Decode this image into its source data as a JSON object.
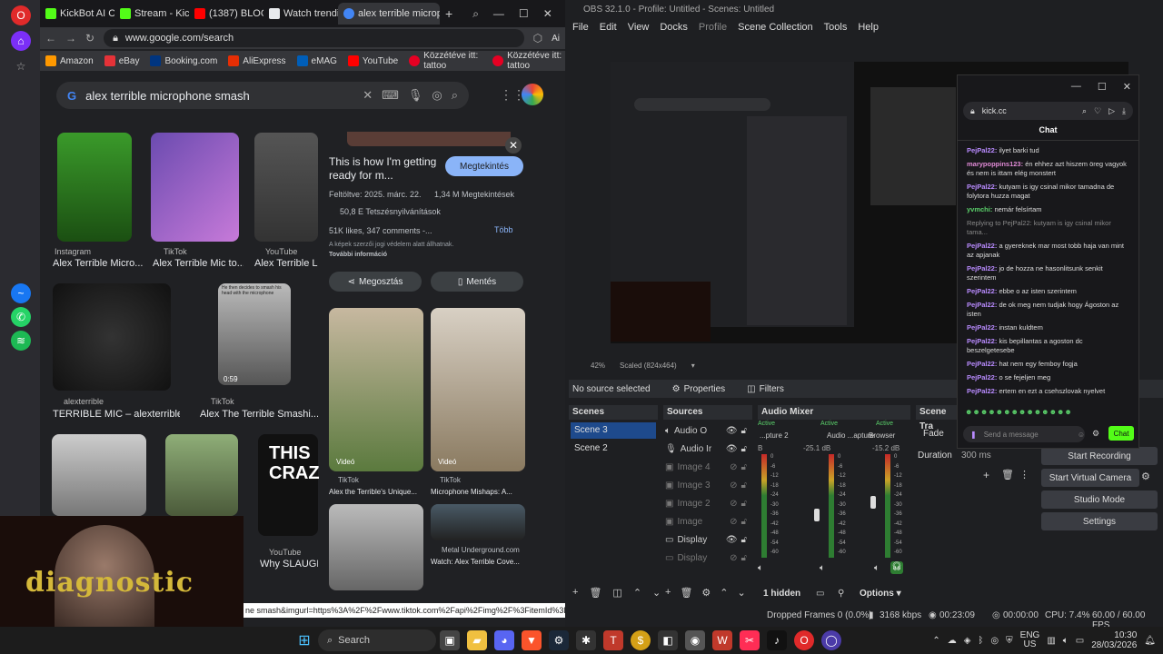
{
  "browser": {
    "tabs": [
      {
        "label": "KickBot AI Chara",
        "color": "#53fc18"
      },
      {
        "label": "Stream - Kick Da",
        "color": "#53fc18"
      },
      {
        "label": "(1387) BLOODY",
        "color": "#ff0000"
      },
      {
        "label": "Watch trending",
        "color": "#e8eaed"
      },
      {
        "label": "alex terrible microphone",
        "color": "#4285f4"
      }
    ],
    "url": "www.google.com/search",
    "bookmarks": [
      "Amazon",
      "eBay",
      "Booking.com",
      "AliExpress",
      "eMAG",
      "YouTube",
      "Közzétéve itt: tattoo",
      "Közzétéve itt: tattoo"
    ],
    "search_query": "alex terrible microphone smash",
    "results": [
      {
        "source": "Instagram",
        "title": "Alex Terrible Micro..."
      },
      {
        "source": "TikTok",
        "title": "Alex Terrible Mic to..."
      },
      {
        "source": "YouTube",
        "title": "Alex Terrible Los"
      },
      {
        "source": "alexterrible",
        "title": "TERRIBLE MIC – alexterrible"
      },
      {
        "source": "TikTok",
        "title": "Alex The Terrible Smashi..."
      },
      {
        "source": "YouTube",
        "title": "Why SLAUGHT"
      }
    ],
    "thumb_texts": {
      "video_caption": "He then decides to smash his head with the microphone",
      "duration": "0:59",
      "this_crazy": "THIS CRAZ"
    },
    "preview": {
      "title": "This is how I'm getting ready for m...",
      "visit_label": "Megtekintés",
      "published": "Feltöltve: 2025. márc. 22.",
      "views": "1,34 M Megtekintések",
      "likes_pct": "50,8 E Tetszésnyilvánítások",
      "likes_comments": "51K likes, 347 comments -...",
      "more": "Több",
      "copyright": "A képek szerzői jogi védelem alatt állhatnak.",
      "more_info": "További információ",
      "share": "Megosztás",
      "save": "Mentés",
      "video_label": "Videó",
      "cards": [
        {
          "source": "TikTok",
          "title": "Alex the Terrible's Unique..."
        },
        {
          "source": "TikTok",
          "title": "Microphone Mishaps: A..."
        },
        {
          "source": "Metal Underground.com",
          "title": "Watch: Alex Terrible Cove..."
        }
      ]
    },
    "status_link": "ne smash&imgurl=https%3A%2F%2Fwww.tiktok.com%2Fapi%2Fimg%2F%3FitemId%3D7..."
  },
  "webcam_overlay": "diagnostic",
  "obs": {
    "title": "OBS 32.1.0 - Profile: Untitled - Scenes: Untitled",
    "menu": [
      "File",
      "Edit",
      "View",
      "Docks",
      "Profile",
      "Scene Collection",
      "Tools",
      "Help"
    ],
    "zoom": "42%",
    "scaled": "Scaled (824x464)",
    "no_source": "No source selected",
    "properties": "Properties",
    "filters": "Filters",
    "scenes_header": "Scenes",
    "scenes": [
      "Scene 3",
      "Scene 2"
    ],
    "sources_header": "Sources",
    "sources": [
      {
        "name": "Audio O",
        "visible": true,
        "locked": false
      },
      {
        "name": "Audio Ir",
        "visible": true,
        "locked": false
      },
      {
        "name": "Image 4",
        "visible": false,
        "locked": false
      },
      {
        "name": "Image 3",
        "visible": false,
        "locked": false
      },
      {
        "name": "Image 2",
        "visible": false,
        "locked": false
      },
      {
        "name": "Image",
        "visible": false,
        "locked": false
      },
      {
        "name": "Display",
        "visible": true,
        "locked": false
      },
      {
        "name": "Display",
        "visible": false,
        "locked": false
      }
    ],
    "mixer_header": "Audio Mixer",
    "mixer": [
      {
        "state": "Active",
        "name": "...pture 2",
        "db": ""
      },
      {
        "state": "Active",
        "name": "Audio ...apture",
        "db": "-25.1 dB"
      },
      {
        "state": "Active",
        "name": "Browser",
        "db": "-15.2 dB"
      }
    ],
    "mixer_ticks": [
      "0",
      "-6",
      "-12",
      "-18",
      "-24",
      "-30",
      "-36",
      "-42",
      "-48",
      "-54",
      "-60"
    ],
    "hidden": "1 hidden",
    "options": "Options",
    "transitions_header": "Scene Tra",
    "transition": "Fade",
    "duration_label": "Duration",
    "duration": "300 ms",
    "controls": [
      "Start Recording",
      "Start Virtual Camera",
      "Studio Mode",
      "Settings"
    ],
    "status": {
      "dropped": "Dropped Frames 0 (0.0%)",
      "kbps": "3168 kbps",
      "live": "00:23:09",
      "rec": "00:00:00",
      "cpu": "CPU: 7.4%",
      "fps": "60.00 / 60.00 FPS"
    }
  },
  "chat": {
    "url": "kick.cc",
    "title": "Chat",
    "messages": [
      {
        "user": "PejPal22:",
        "text": "ilyet barki tud",
        "color": "purple"
      },
      {
        "user": "marypoppins123:",
        "text": "én ehhez azt hiszem öreg vagyok és nem is ittam elég monstert",
        "color": "pink"
      },
      {
        "user": "PejPal22:",
        "text": "kutyam is igy csinal mikor tamadna de folytora huzza magat",
        "color": "purple"
      },
      {
        "user": "yvmchi:",
        "text": "nemár felsírtam",
        "color": "green"
      },
      {
        "user": "PejPal22:",
        "text": "a gyereknek mar most tobb haja van mint az apjanak",
        "color": "purple"
      },
      {
        "user": "PejPal22:",
        "text": "jo de hozza ne hasonlitsunk senkit szerintem",
        "color": "purple"
      },
      {
        "user": "PejPal22:",
        "text": "ebbe o az isten szerintem",
        "color": "purple"
      },
      {
        "user": "PejPal22:",
        "text": "de ok meg nem tudjak hogy Ágoston az isten",
        "color": "purple"
      },
      {
        "user": "PejPal22:",
        "text": "instan kuldtem",
        "color": "purple"
      },
      {
        "user": "PejPal22:",
        "text": "kis bepillantas a agoston dc beszelgetesebe",
        "color": "purple"
      },
      {
        "user": "PejPal22:",
        "text": "hat nem egy femboy fogja",
        "color": "purple"
      },
      {
        "user": "PejPal22:",
        "text": "o se fejeljen meg",
        "color": "purple"
      },
      {
        "user": "PejPal22:",
        "text": "ertem en ezt a csehszlovak nyelvet",
        "color": "purple"
      }
    ],
    "reply_note": "Replying to PejPal22: kutyam is igy csinal mikor tama...",
    "placeholder": "Send a message",
    "send": "Chat"
  },
  "taskbar": {
    "search": "Search",
    "lang": "ENG",
    "region": "US",
    "time": "10:30",
    "date": "28/03/2026"
  }
}
